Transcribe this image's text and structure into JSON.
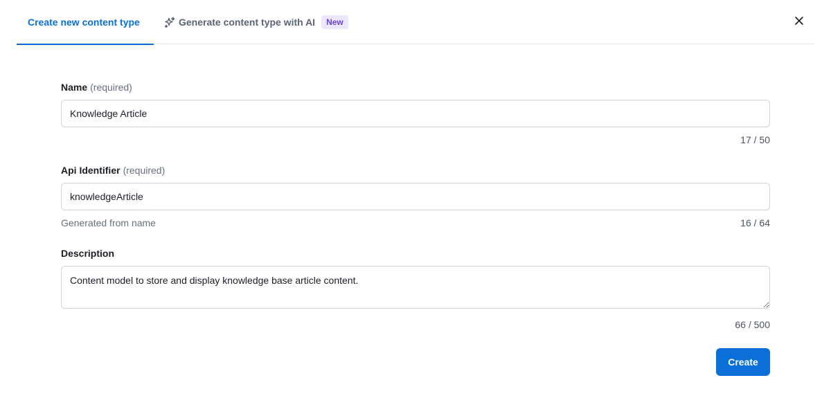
{
  "tabs": {
    "create_label": "Create new content type",
    "ai_label": "Generate content type with AI",
    "ai_badge": "New"
  },
  "icons": {
    "close": "close-icon",
    "sparkle": "sparkle-icon"
  },
  "form": {
    "name": {
      "label": "Name",
      "required": "(required)",
      "value": "Knowledge Article",
      "counter": "17 / 50"
    },
    "api_identifier": {
      "label": "Api Identifier",
      "required": "(required)",
      "value": "knowledgeArticle",
      "hint": "Generated from name",
      "counter": "16 / 64"
    },
    "description": {
      "label": "Description",
      "value": "Content model to store and display knowledge base article content.",
      "counter": "66 / 500"
    },
    "create_label": "Create"
  },
  "colors": {
    "accent": "#0a6fd6",
    "badge_bg": "#ece6ff",
    "badge_text": "#6b43d6"
  }
}
